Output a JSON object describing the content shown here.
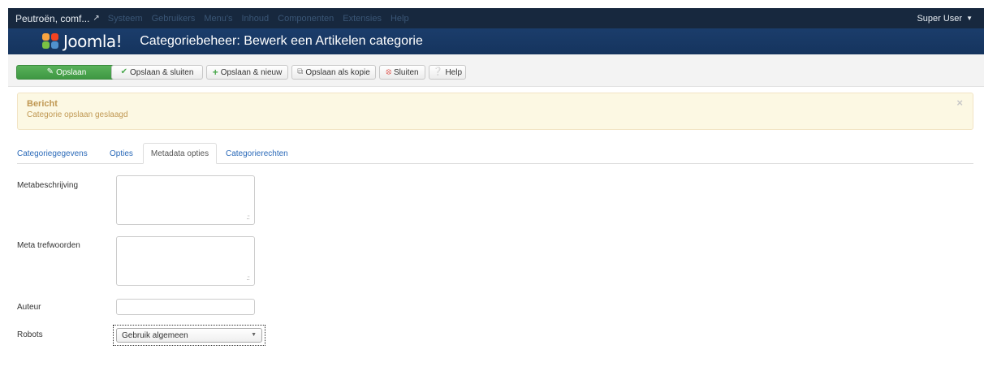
{
  "topbar": {
    "site_name": "Peutroën, comf...",
    "site_external_icon": "external-link-icon",
    "menu": [
      "Systeem",
      "Gebruikers",
      "Menu's",
      "Inhoud",
      "Componenten",
      "Extensies",
      "Help"
    ],
    "user": "Super User"
  },
  "header": {
    "logo_text": "Joomla!",
    "page_title": "Categoriebeheer: Bewerk een Artikelen categorie"
  },
  "toolbar": {
    "save": "Opslaan",
    "save_close": "Opslaan & sluiten",
    "save_new": "Opslaan & nieuw",
    "save_copy": "Opslaan als kopie",
    "close": "Sluiten",
    "help": "Help"
  },
  "alert": {
    "heading": "Bericht",
    "message": "Categorie opslaan geslaagd",
    "close": "×"
  },
  "tabs": {
    "details": "Categoriegegevens",
    "options": "Opties",
    "metadata": "Metadata opties",
    "permissions": "Categorierechten"
  },
  "form": {
    "meta_description_label": "Metabeschrijving",
    "meta_description_value": "",
    "meta_keywords_label": "Meta trefwoorden",
    "meta_keywords_value": "",
    "author_label": "Auteur",
    "author_value": "",
    "robots_label": "Robots",
    "robots_value": "Gebruik algemeen"
  },
  "colors": {
    "topbar_bg": "#17283e",
    "header_bg": "#1b3d6b",
    "primary_green": "#4aa84d",
    "alert_bg": "#fcf8e3",
    "alert_text": "#c09853",
    "link_blue": "#2a69b8"
  }
}
